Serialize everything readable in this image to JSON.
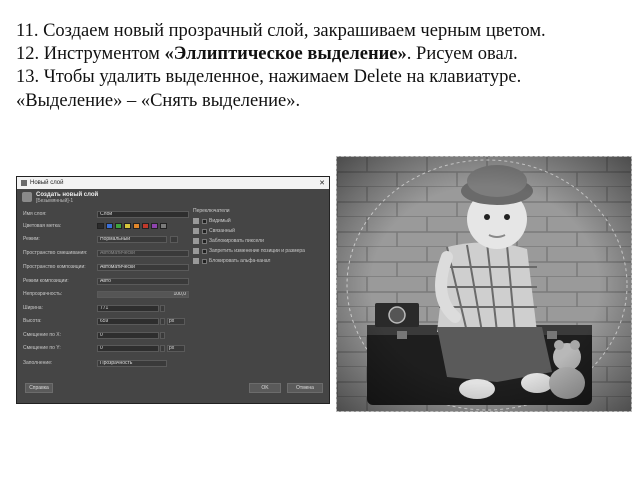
{
  "instructions": {
    "step11": "11. Создаем новый прозрачный слой,  закрашиваем черным цветом.",
    "step12_pre": "12. Инструментом ",
    "step12_bold": "«Эллиптическое выделение»",
    "step12_post": ". Рисуем овал.",
    "step13": "13. Чтобы удалить выделенное, нажимаем Delete на клавиатуре. «Выделение» – «Снять выделение»."
  },
  "dialog": {
    "window_title": "Новый слой",
    "header_title": "Создать новый слой",
    "header_subtitle": "[Безымянный]-1",
    "fields": {
      "name_label": "Имя слоя:",
      "name_value": "Слой",
      "color_tag_label": "Цветовая метка:",
      "mode_label": "Режим:",
      "mode_value": "Нормальный",
      "blend_space_label": "Пространство смешивания:",
      "blend_space_value": "Автоматически",
      "composite_space_label": "Пространство композиции:",
      "composite_space_value": "Автоматически",
      "composite_mode_label": "Режим композиции:",
      "composite_mode_value": "Авто",
      "opacity_label": "Непрозрачность:",
      "opacity_value": "100,0",
      "width_label": "Ширина:",
      "width_value": "771",
      "height_label": "Высота:",
      "height_value": "659",
      "offset_x_label": "Смещение по X:",
      "offset_x_value": "0",
      "offset_y_label": "Смещение по Y:",
      "offset_y_value": "0",
      "unit_value": "px",
      "fill_label": "Заполнение:",
      "fill_value": "Прозрачность"
    },
    "attributes": {
      "header": "Переключатели",
      "items": [
        "Видимый",
        "Связанный",
        "Заблокировать пиксели",
        "Запретить изменение позиции и размера",
        "Блокировать альфа-канал"
      ]
    },
    "buttons": {
      "help": "Справка",
      "ok": "OK",
      "cancel": "Отмена"
    },
    "tag_colors": [
      "#2b2b2b",
      "#3a6fd8",
      "#3ea43e",
      "#d6c53a",
      "#e0862a",
      "#c0392b",
      "#8e44ad",
      "#7a7a7a"
    ]
  },
  "photo": {
    "alt": "child-on-suitcase-photo"
  }
}
